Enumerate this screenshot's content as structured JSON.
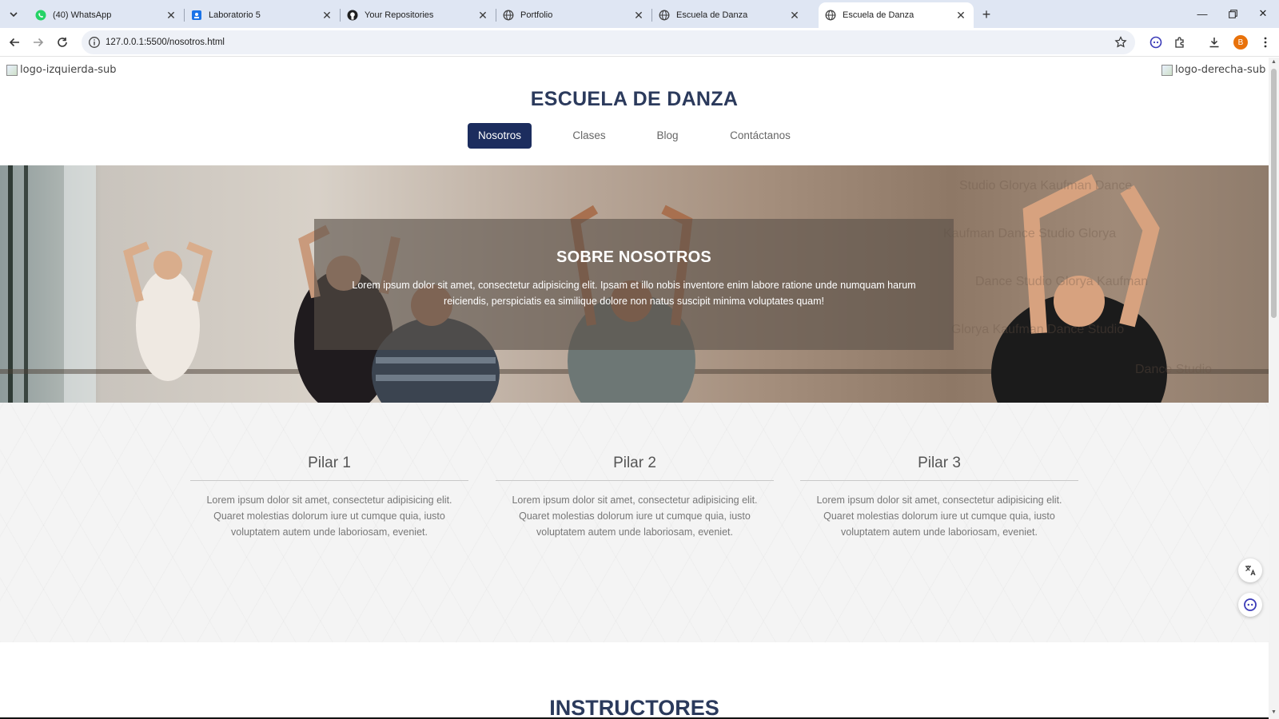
{
  "browser": {
    "tabs": [
      {
        "title": "(40) WhatsApp",
        "icon": "whatsapp-icon"
      },
      {
        "title": "Laboratorio 5",
        "icon": "classroom-icon"
      },
      {
        "title": "Your Repositories",
        "icon": "github-icon"
      },
      {
        "title": "Portfolio",
        "icon": "globe-icon"
      },
      {
        "title": "Escuela de Danza",
        "icon": "globe-icon"
      },
      {
        "title": "Escuela de Danza",
        "icon": "globe-icon",
        "active": true
      }
    ],
    "url": "127.0.0.1:5500/nosotros.html",
    "profile_initial": "B"
  },
  "page": {
    "logo_left_alt": "logo-izquierda-sub",
    "logo_right_alt": "logo-derecha-sub",
    "site_title": "ESCUELA DE DANZA",
    "nav": [
      {
        "label": "Nosotros",
        "active": true
      },
      {
        "label": "Clases"
      },
      {
        "label": "Blog"
      },
      {
        "label": "Contáctanos"
      }
    ],
    "hero": {
      "title": "SOBRE NOSOTROS",
      "text": "Lorem ipsum dolor sit amet, consectetur adipisicing elit. Ipsam et illo nobis inventore enim labore ratione unde numquam harum reiciendis, perspiciatis ea similique dolore non natus suscipit minima voluptates quam!"
    },
    "pillars": [
      {
        "title": "Pilar 1",
        "text": "Lorem ipsum dolor sit amet, consectetur adipisicing elit. Quaret molestias dolorum iure ut cumque quia, iusto voluptatem autem unde laboriosam, eveniet."
      },
      {
        "title": "Pilar 2",
        "text": "Lorem ipsum dolor sit amet, consectetur adipisicing elit. Quaret molestias dolorum iure ut cumque quia, iusto voluptatem autem unde laboriosam, eveniet."
      },
      {
        "title": "Pilar 3",
        "text": "Lorem ipsum dolor sit amet, consectetur adipisicing elit. Quaret molestias dolorum iure ut cumque quia, iusto voluptatem autem unde laboriosam, eveniet."
      }
    ],
    "instructors_title": "INSTRUCTORES"
  },
  "colors": {
    "navy": "#1c2d5e",
    "title": "#2b3a5c",
    "tabbar": "#dfe6f3",
    "whatsapp": "#25d366",
    "classroom": "#1a73e8",
    "profile": "#e8710a"
  }
}
